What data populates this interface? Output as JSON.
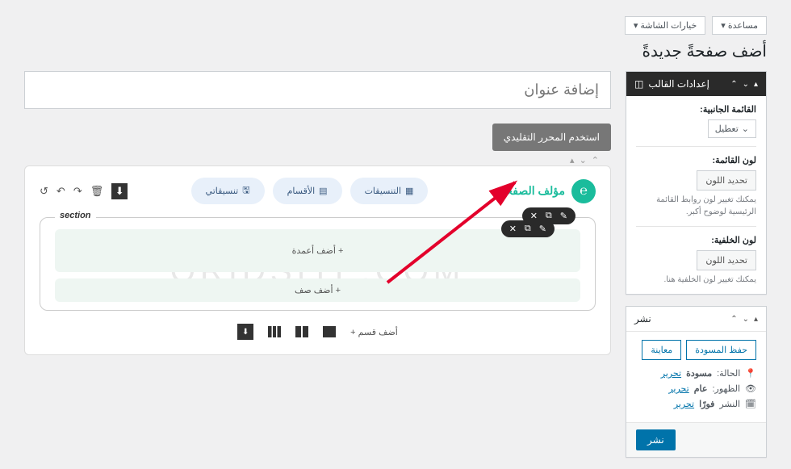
{
  "topbar": {
    "help": "مساعدة",
    "screen_options": "خيارات الشاشة"
  },
  "page_title": "أضف صفحةً جديدةً",
  "title_placeholder": "إضافة عنوان",
  "classic_editor_btn": "استخدم المحرر التقليدي",
  "theme_box": {
    "title": "إعدادات القالب",
    "sidebar_label": "القائمة الجانبية:",
    "sidebar_value": "تعطيل",
    "menu_color_label": "لون القائمة:",
    "color_btn": "تحديد اللون",
    "menu_color_hint": "يمكنك تغيير لون روابط القائمة الرئيسية لوضوح أكبر.",
    "bg_color_label": "لون الخلفية:",
    "bg_color_hint": "يمكنك تغيير لون الخلفية هنا."
  },
  "publish_box": {
    "title": "نشر",
    "save_draft": "حفظ المسودة",
    "preview": "معاينة",
    "status_label": "الحالة:",
    "status_value": "مسودة",
    "edit": "تحرير",
    "visibility_label": "الظهور:",
    "visibility_value": "عام",
    "schedule_label": "النشر",
    "schedule_value": "فورًا",
    "publish": "نشر"
  },
  "builder": {
    "brand": "مؤلف الصفحات",
    "pills": {
      "layouts": "التنسيقات",
      "sections": "الأقسام",
      "my_layouts": "تنسيقاتي"
    },
    "section_label": "section",
    "add_cols": "+  أضف أعمدة",
    "add_row": "+  أضف صف",
    "add_section": "أضف قسم  +"
  },
  "watermark": "ORIDSITE.COM"
}
